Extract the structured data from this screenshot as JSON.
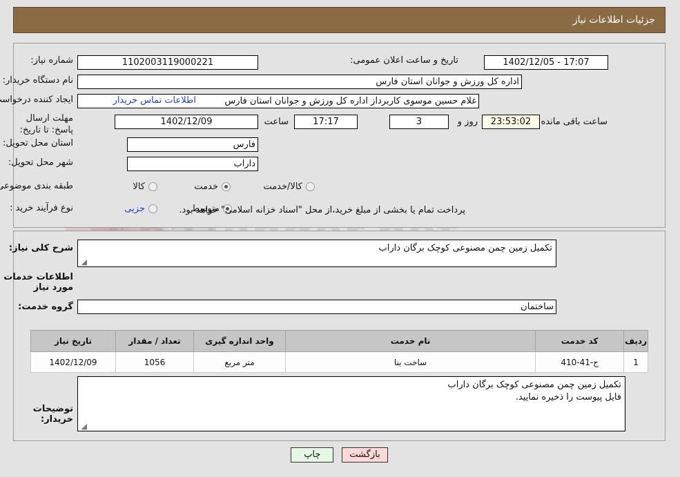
{
  "header": {
    "title": "جزئیات اطلاعات نیاز"
  },
  "top_form": {
    "need_number_label": "شماره نیاز:",
    "need_number_value": "1102003119000221",
    "announce_datetime_label": "تاریخ و ساعت اعلان عمومی:",
    "announce_datetime_value": "17:07 - 1402/12/05",
    "buyer_org_label": "نام دستگاه خریدار:",
    "buyer_org_value": "اداره کل ورزش و جوانان استان فارس",
    "creator_label": "ایجاد کننده درخواست:",
    "creator_value": "غلام حسین موسوی کاربرداز اداره کل ورزش و جوانان استان فارس",
    "contact_link": "اطلاعات تماس خریدار",
    "deadline_label": "مهلت ارسال پاسخ: تا تاریخ:",
    "deadline_date": "1402/12/09",
    "deadline_hour_label": "ساعت",
    "deadline_hour": "17:17",
    "remaining_days": "3",
    "remaining_days_label": "روز و",
    "remaining_time": "23:53:02",
    "remaining_time_label": "ساعت باقی مانده",
    "province_label": "استان محل تحویل:",
    "province_value": "فارس",
    "city_label": "شهر محل تحویل:",
    "city_value": "داراب",
    "category_label": "طبقه بندی موضوعی:",
    "category_options": [
      {
        "label": "کالا",
        "selected": false
      },
      {
        "label": "خدمت",
        "selected": true
      },
      {
        "label": "کالا/خدمت",
        "selected": false
      }
    ],
    "process_type_label": "نوع فرآیند خرید :",
    "process_options": [
      {
        "label": "جزیی",
        "selected": false
      },
      {
        "label": "متوسط",
        "selected": true
      }
    ],
    "treasury_note": "پرداخت تمام یا بخشی از مبلغ خرید،از محل \"اسناد خزانه اسلامی\" خواهد بود."
  },
  "bottom_form": {
    "general_desc_label": "شرح کلی نیاز:",
    "general_desc_value": "تکمیل زمین چمن مصنوعی کوچک برگان داراب",
    "services_section_title": "اطلاعات خدمات مورد نیاز",
    "service_group_label": "گروه خدمت:",
    "service_group_value": "ساختمان",
    "buyer_notes_label": "توضیحات خریدار:",
    "buyer_notes_line1": "تکمیل زمین چمن مصنوعی کوچک برگان داراب",
    "buyer_notes_line2": "فایل پیوست را ذخیره نمایید."
  },
  "table": {
    "columns": [
      "ردیف",
      "کد خدمت",
      "نام خدمت",
      "واحد اندازه گیری",
      "تعداد / مقدار",
      "تاریخ نیاز"
    ],
    "rows": [
      {
        "row_no": "1",
        "service_code": "ج-41-410",
        "service_name": "ساخت بنا",
        "unit": "متر مربع",
        "quantity": "1056",
        "need_date": "1402/12/09"
      }
    ]
  },
  "buttons": {
    "print": "چاپ",
    "back": "بازگشت"
  },
  "watermark": {
    "text": "AnaTender.net"
  },
  "colors": {
    "header_bg": "#8b6b44",
    "page_bg": "#e3e3e3",
    "link": "#1f3fd0",
    "table_header_bg": "#c6c6c6",
    "btn_print_bg": "#e6f7e6",
    "btn_back_bg": "#fbd9d9",
    "countdown_bg": "#fbfbe8"
  }
}
